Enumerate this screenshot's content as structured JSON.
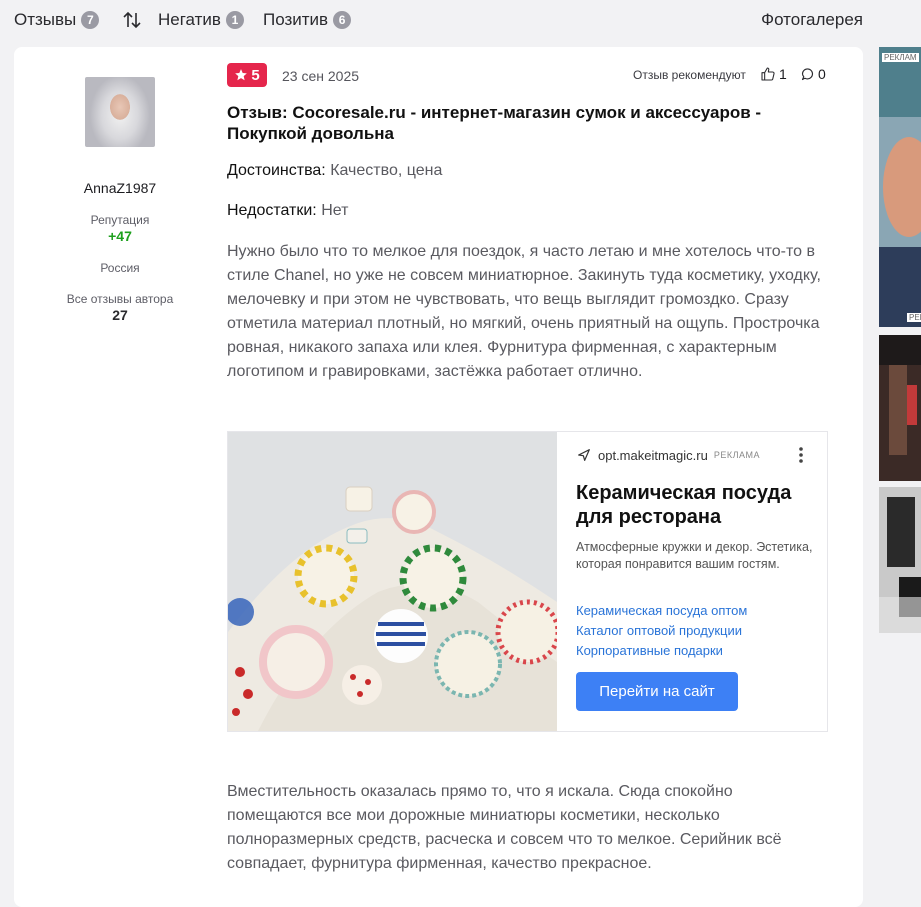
{
  "tabs": {
    "reviews_label": "Отзывы",
    "reviews_count": "7",
    "negative_label": "Негатив",
    "negative_count": "1",
    "positive_label": "Позитив",
    "positive_count": "6",
    "gallery_label": "Фотогалерея",
    "sort_icon": "sort-arrows-icon"
  },
  "author": {
    "name": "AnnaZ1987",
    "reputation_label": "Репутация",
    "reputation_value": "+47",
    "reputation_color": "#1ea01e",
    "country": "Россия",
    "all_reviews_label": "Все отзывы автора",
    "all_reviews_count": "27"
  },
  "review": {
    "rating": "5",
    "rating_color": "#e5264c",
    "date": "23 сен 2025",
    "recommend_label": "Отзыв рекомендуют",
    "likes": "1",
    "comments": "0",
    "title": "Отзыв: Cocoresale.ru - интернет-магазин сумок и аксессуаров - Покупкой довольна",
    "pros_label": "Достоинства:",
    "pros_value": "Качество, цена",
    "cons_label": "Недостатки:",
    "cons_value": "Нет",
    "paragraph1": "Нужно было что то мелкое для поездок, я часто летаю и мне хотелось что-то в стиле Chanel, но уже не совсем миниатюрное. Закинуть туда косметику, уходку, мелочевку и при этом не чувствовать, что вещь выглядит громоздко. Сразу отметила материал плотный, но мягкий, очень приятный на ощупь. Прострочка ровная, никакого запаха или клея. Фурнитура фирменная, с характерным логотипом и гравировками, застёжка работает отлично.",
    "paragraph2": "Вместительность оказалась прямо то, что я искала. Сюда спокойно помещаются все мои дорожные миниатюры косметики, несколько полноразмерных средств, расческа и совсем что то мелкое. Серийник всё совпадает, фурнитура фирменная, качество прекрасное."
  },
  "ad": {
    "domain": "opt.makeitmagic.ru",
    "tag": "РЕКЛАМА",
    "title": "Керамическая посуда для ресторана",
    "description": "Атмосферные кружки и декор. Эстетика, которая понравится вашим гостям.",
    "links": [
      "Керамическая посуда оптом",
      "Каталог оптовой продукции",
      "Корпоративные подарки"
    ],
    "button": "Перейти на сайт",
    "button_color": "#3d80f5",
    "link_color": "#2a74d8"
  },
  "sidebar_ads": {
    "tag_top": "РЕКЛАМ",
    "tag_bottom": "РЕК"
  }
}
